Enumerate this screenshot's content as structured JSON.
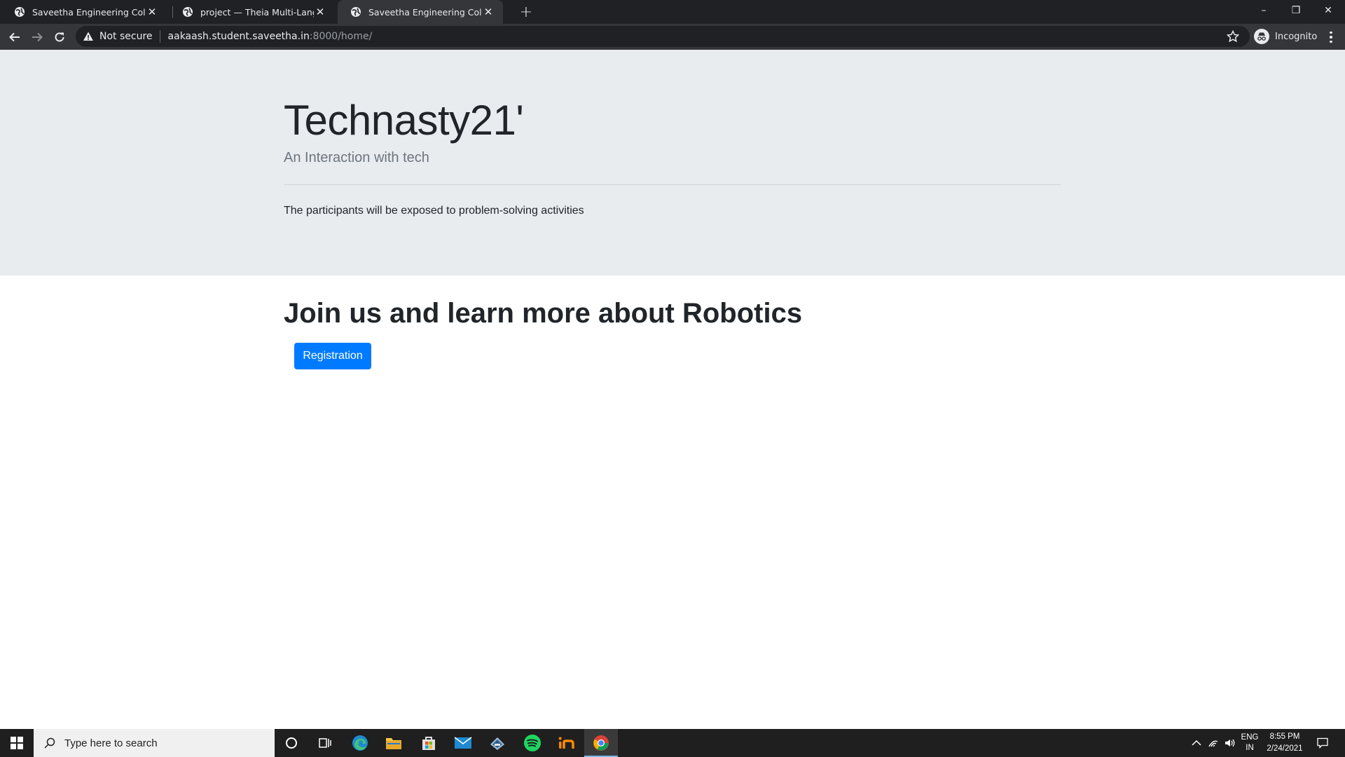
{
  "browser": {
    "tabs": [
      {
        "title": "Saveetha Engineering College",
        "active": false
      },
      {
        "title": "project — Theia Multi-Language",
        "active": false
      },
      {
        "title": "Saveetha Engineering College",
        "active": true
      }
    ],
    "new_tab_label": "+",
    "window_controls": {
      "minimize": "–",
      "restore": "❐",
      "close": "✕"
    },
    "security_label": "Not secure",
    "url_host": "aakaash.student.saveetha.in",
    "url_rest": ":8000/home/",
    "profile_label": "Incognito"
  },
  "page": {
    "title": "Technasty21'",
    "subtitle": "An Interaction with tech",
    "description": "The participants will be exposed to problem-solving activities",
    "section_heading": "Join us and learn more about Robotics",
    "button_label": "Registration"
  },
  "taskbar": {
    "search_placeholder": "Type here to search",
    "apps": [
      "cortana-icon",
      "task-view-icon",
      "edge-icon",
      "file-explorer-icon",
      "store-icon",
      "mail-icon",
      "app-icon",
      "spotify-icon",
      "invision-icon",
      "chrome-icon"
    ],
    "language": "ENG",
    "region": "IN",
    "time": "8:55 PM",
    "date": "2/24/2021"
  },
  "colors": {
    "accent": "#007bff",
    "jumbotron_bg": "#e9ecef",
    "browser_dark": "#202124",
    "browser_toolbar": "#35363a",
    "taskbar_bg": "#1f1f1f"
  }
}
